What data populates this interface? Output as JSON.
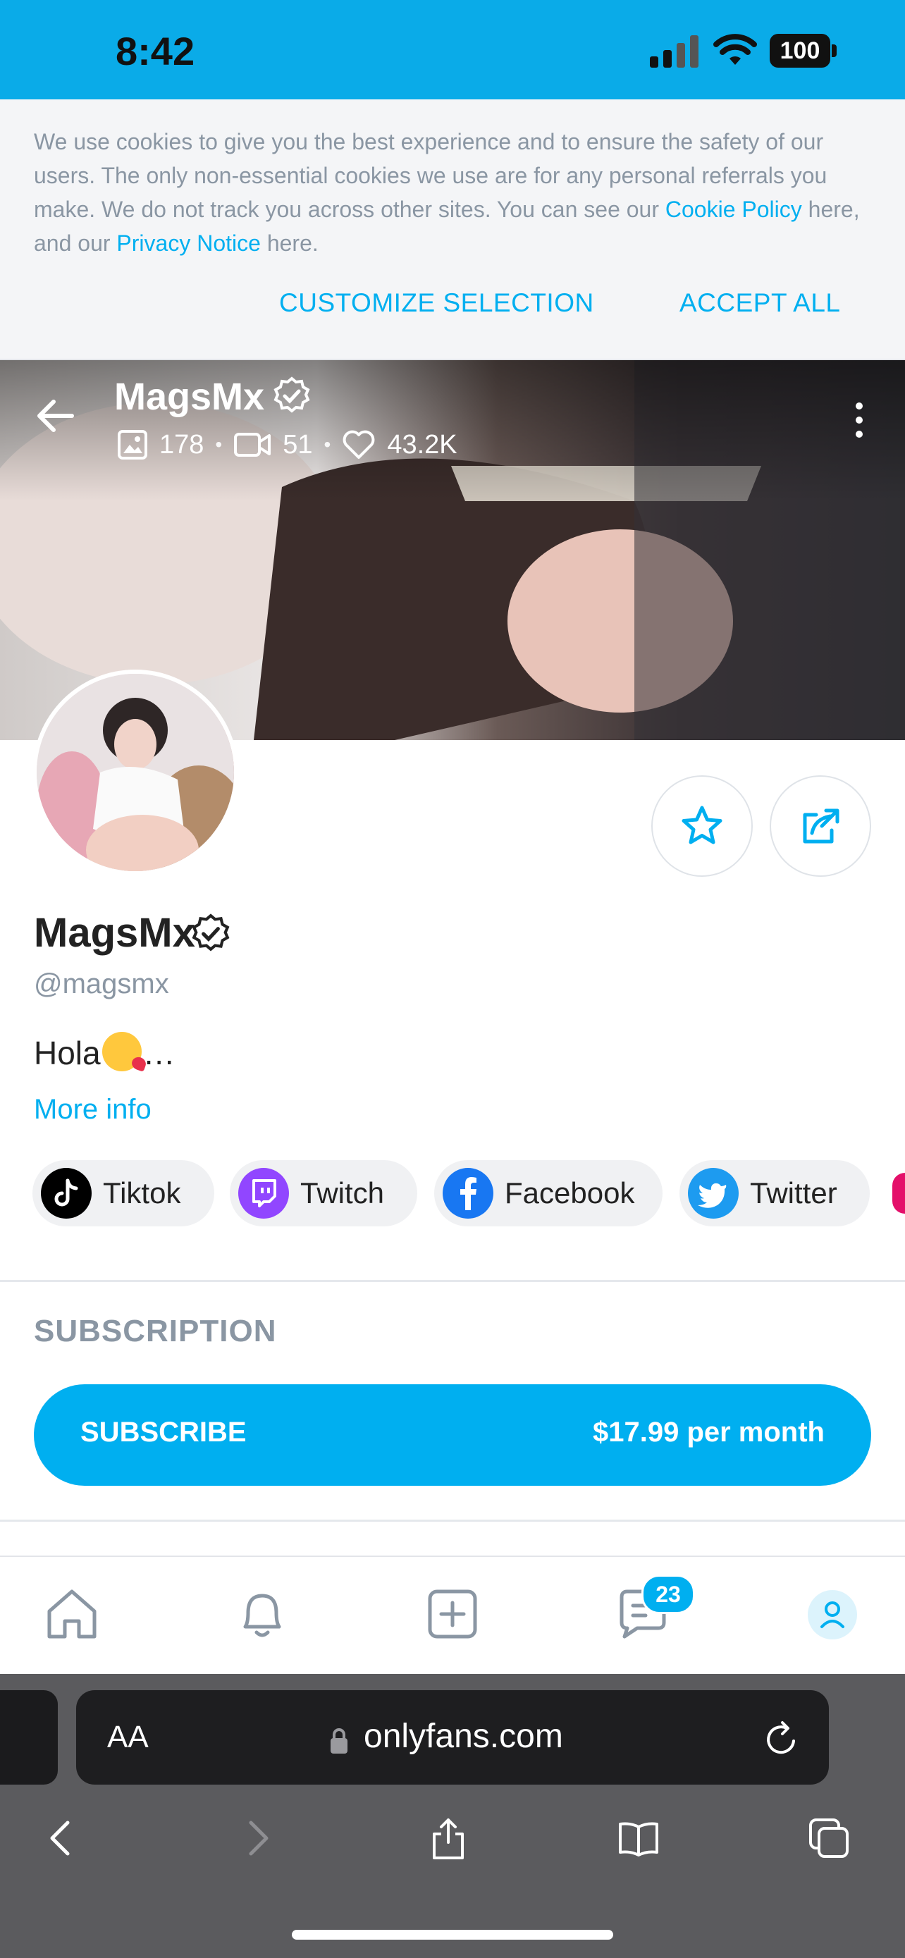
{
  "status_bar": {
    "time": "8:42",
    "battery": "100"
  },
  "cookie_banner": {
    "text_1": "We use cookies to give you the best experience and to ensure the safety of our users. The only non-essential cookies we use are for any personal referrals you make. We do not track you across other sites. You can see our ",
    "cookie_policy_link": "Cookie Policy",
    "text_2": " here, and our ",
    "privacy_link": "Privacy Notice",
    "text_3": " here.",
    "customize_label": "CUSTOMIZE SELECTION",
    "accept_label": "ACCEPT ALL"
  },
  "header": {
    "name": "MagsMx",
    "photos_count": "178",
    "videos_count": "51",
    "likes_count": "43.2K"
  },
  "profile": {
    "name": "MagsMx",
    "handle": "@magsmx",
    "bio_prefix": "Hola",
    "bio_suffix": "…",
    "more_info": "More info"
  },
  "socials": [
    {
      "label": "Tiktok",
      "icon": "tiktok-icon",
      "color": "#000000"
    },
    {
      "label": "Twitch",
      "icon": "twitch-icon",
      "color": "#9146ff"
    },
    {
      "label": "Facebook",
      "icon": "facebook-icon",
      "color": "#1877f2"
    },
    {
      "label": "Twitter",
      "icon": "twitter-icon",
      "color": "#1d9bf0"
    }
  ],
  "subscription": {
    "heading": "SUBSCRIPTION",
    "button_label": "SUBSCRIBE",
    "price": "$17.99 per month"
  },
  "bottom_nav": {
    "messages_badge": "23"
  },
  "browser": {
    "aa_label": "AA",
    "url": "onlyfans.com"
  },
  "colors": {
    "accent": "#00aff0",
    "status_bar": "#0aabe8",
    "muted_text": "#8a96a3"
  }
}
